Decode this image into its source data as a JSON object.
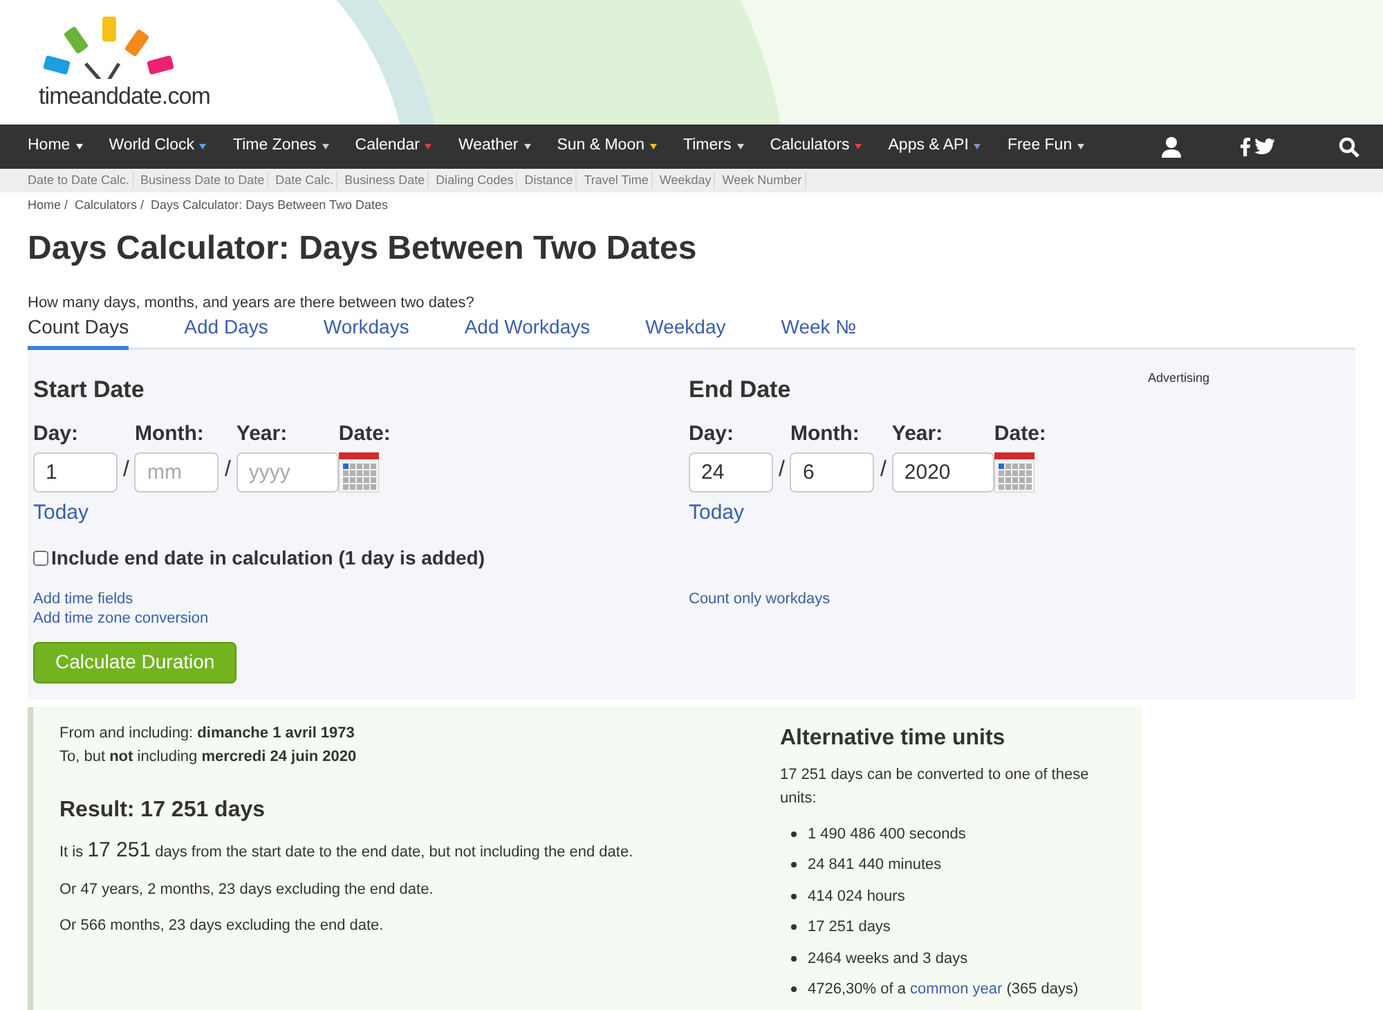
{
  "logo": {
    "text": "timeanddate.com"
  },
  "nav": [
    {
      "label": "Home",
      "color": "#ffffff"
    },
    {
      "label": "World Clock",
      "color": "#5aa0e0"
    },
    {
      "label": "Time Zones",
      "color": "#c8c8c8"
    },
    {
      "label": "Calendar",
      "color": "#e0404a"
    },
    {
      "label": "Weather",
      "color": "#d8d8d8"
    },
    {
      "label": "Sun & Moon",
      "color": "#f0c020"
    },
    {
      "label": "Timers",
      "color": "#d8d8d8"
    },
    {
      "label": "Calculators",
      "color": "#e0404a"
    },
    {
      "label": "Apps & API",
      "color": "#8090c0"
    },
    {
      "label": "Free Fun",
      "color": "#d8d8d8"
    }
  ],
  "subnav": [
    "Date to Date Calc.",
    "Business Date to Date",
    "Date Calc.",
    "Business Date",
    "Dialing Codes",
    "Distance",
    "Travel Time",
    "Weekday",
    "Week Number"
  ],
  "breadcrumb": [
    "Home /",
    "Calculators /",
    "Days Calculator: Days Between Two Dates"
  ],
  "title": "Days Calculator: Days Between Two Dates",
  "subtitle": "How many days, months, and years are there between two dates?",
  "tabs": [
    {
      "label": "Count Days",
      "selected": true
    },
    {
      "label": "Add Days",
      "selected": false
    },
    {
      "label": "Workdays",
      "selected": false
    },
    {
      "label": "Add Workdays",
      "selected": false
    },
    {
      "label": "Weekday",
      "selected": false
    },
    {
      "label": "Week №",
      "selected": false
    }
  ],
  "dates": [
    {
      "heading": "Start Date",
      "day": {
        "label": "Day:",
        "value": "1"
      },
      "month": {
        "label": "Month:",
        "placeholder": "mm"
      },
      "year": {
        "label": "Year:",
        "placeholder": "yyyy"
      },
      "date_label": "Date:",
      "separators": [
        "/",
        "/"
      ],
      "today": "Today"
    },
    {
      "heading": "End Date",
      "day": {
        "label": "Day:",
        "value": "24"
      },
      "month": {
        "label": "Month:",
        "value": "6"
      },
      "year": {
        "label": "Year:",
        "value": "2020"
      },
      "date_label": "Date:",
      "separators": [
        "/",
        "/"
      ],
      "today": "Today"
    }
  ],
  "advertising": "Advertising",
  "include_end": {
    "label": "Include end date in calculation (1 day is added)",
    "checked": false
  },
  "left_links": [
    "Add time fields",
    "Add time zone conversion"
  ],
  "right_links": [
    "Count only workdays"
  ],
  "calculate_button": "Calculate Duration",
  "result": {
    "from": "From and including: **dimanche 1 avril 1973**",
    "to": "To, but **not** including **mercredi 24 juin 2020**",
    "heading": "Result: 17 251 days",
    "main": {
      "before": "It is",
      "number": "17 251",
      "after": "days from the start date to the end date, but not including the end date."
    },
    "lines": [
      "Or 47 years, 2 months, 23 days excluding the end date.",
      "Or 566 months, 23 days excluding the end date."
    ]
  },
  "alternative": {
    "heading": "Alternative time units",
    "intro": "17 251 days can be converted to one of these units:",
    "items": [
      {
        "text": "1 490 486 400 seconds"
      },
      {
        "text": "24 841 440 minutes"
      },
      {
        "text": "414 024 hours"
      },
      {
        "text": "17 251 days"
      },
      {
        "text": "2464 weeks and 3 days"
      },
      {
        "text": "4726,30% of a",
        "link": "common year",
        "after": "(365 days)"
      }
    ]
  }
}
